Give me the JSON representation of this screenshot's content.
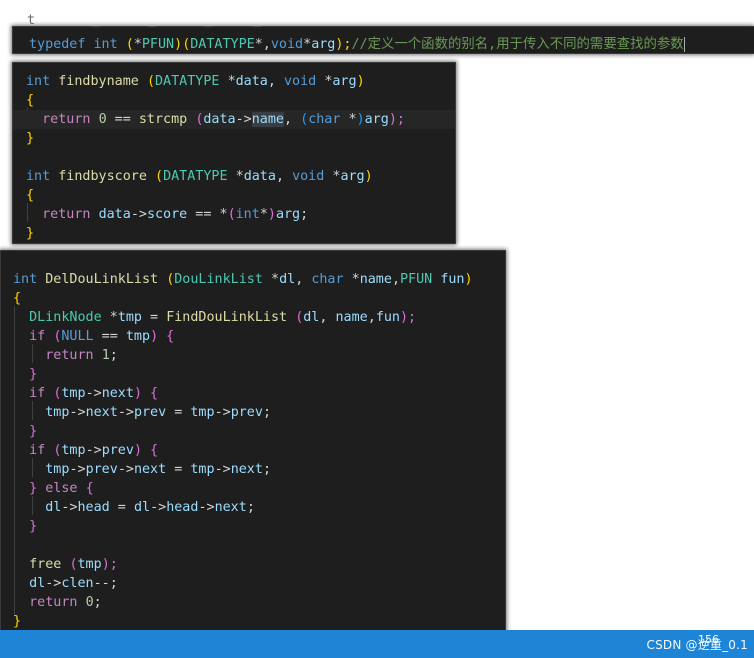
{
  "panel_top": {
    "lines": [
      [
        {
          "t": "typedef ",
          "c": "k"
        },
        {
          "t": "int ",
          "c": "k"
        },
        {
          "t": "(",
          "c": "b1"
        },
        {
          "t": "*",
          "c": "d"
        },
        {
          "t": "PFUN",
          "c": "t"
        },
        {
          "t": ")",
          "c": "b1"
        },
        {
          "t": "(",
          "c": "b1"
        },
        {
          "t": "DATATYPE",
          "c": "t"
        },
        {
          "t": "*,",
          "c": "d"
        },
        {
          "t": "void",
          "c": "k"
        },
        {
          "t": "*",
          "c": "d"
        },
        {
          "t": "arg",
          "c": "p"
        },
        {
          "t": ");",
          "c": "b1"
        },
        {
          "t": "//定义一个函数的别名,用于传入不同的需要查找的参数",
          "c": "cm"
        }
      ]
    ]
  },
  "panel_find": {
    "lines": [
      [
        {
          "t": "int ",
          "c": "k"
        },
        {
          "t": "findbyname ",
          "c": "f"
        },
        {
          "t": "(",
          "c": "b1"
        },
        {
          "t": "DATATYPE ",
          "c": "t"
        },
        {
          "t": "*",
          "c": "d"
        },
        {
          "t": "data",
          "c": "p"
        },
        {
          "t": ", ",
          "c": "d"
        },
        {
          "t": "void ",
          "c": "k"
        },
        {
          "t": "*",
          "c": "d"
        },
        {
          "t": "arg",
          "c": "p"
        },
        {
          "t": ")",
          "c": "b1"
        }
      ],
      [
        {
          "t": "{",
          "c": "b1"
        }
      ],
      [
        {
          "t": "  ",
          "c": "d"
        },
        {
          "t": "return ",
          "c": "c"
        },
        {
          "t": "0",
          "c": "n"
        },
        {
          "t": " == ",
          "c": "d"
        },
        {
          "t": "strcmp ",
          "c": "f"
        },
        {
          "t": "(",
          "c": "b2"
        },
        {
          "t": "data",
          "c": "p"
        },
        {
          "t": "->",
          "c": "d"
        },
        {
          "t": "name",
          "c": "v",
          "sel": true
        },
        {
          "t": ", ",
          "c": "d"
        },
        {
          "t": "(",
          "c": "b3"
        },
        {
          "t": "char ",
          "c": "k"
        },
        {
          "t": "*",
          "c": "d"
        },
        {
          "t": ")",
          "c": "b3"
        },
        {
          "t": "arg",
          "c": "p"
        },
        {
          "t": ");",
          "c": "b2"
        }
      ],
      [
        {
          "t": "}",
          "c": "b1"
        }
      ],
      [],
      [
        {
          "t": "int ",
          "c": "k"
        },
        {
          "t": "findbyscore ",
          "c": "f"
        },
        {
          "t": "(",
          "c": "b1"
        },
        {
          "t": "DATATYPE ",
          "c": "t"
        },
        {
          "t": "*",
          "c": "d"
        },
        {
          "t": "data",
          "c": "p"
        },
        {
          "t": ", ",
          "c": "d"
        },
        {
          "t": "void ",
          "c": "k"
        },
        {
          "t": "*",
          "c": "d"
        },
        {
          "t": "arg",
          "c": "p"
        },
        {
          "t": ")",
          "c": "b1"
        }
      ],
      [
        {
          "t": "{",
          "c": "b1"
        }
      ],
      [
        {
          "t": "  ",
          "c": "d"
        },
        {
          "t": "return ",
          "c": "c"
        },
        {
          "t": "data",
          "c": "p"
        },
        {
          "t": "->",
          "c": "d"
        },
        {
          "t": "score",
          "c": "v"
        },
        {
          "t": " == *",
          "c": "d"
        },
        {
          "t": "(",
          "c": "b2"
        },
        {
          "t": "int",
          "c": "k"
        },
        {
          "t": "*",
          "c": "d"
        },
        {
          "t": ")",
          "c": "b2"
        },
        {
          "t": "arg",
          "c": "p"
        },
        {
          "t": ";",
          "c": "d"
        }
      ],
      [
        {
          "t": "}",
          "c": "b1"
        }
      ]
    ]
  },
  "panel_del": {
    "lines": [
      [
        {
          "t": "int ",
          "c": "k"
        },
        {
          "t": "DelDouLinkList ",
          "c": "f"
        },
        {
          "t": "(",
          "c": "b1"
        },
        {
          "t": "DouLinkList ",
          "c": "t"
        },
        {
          "t": "*",
          "c": "d"
        },
        {
          "t": "dl",
          "c": "p"
        },
        {
          "t": ", ",
          "c": "d"
        },
        {
          "t": "char ",
          "c": "k"
        },
        {
          "t": "*",
          "c": "d"
        },
        {
          "t": "name",
          "c": "p"
        },
        {
          "t": ",",
          "c": "d"
        },
        {
          "t": "PFUN ",
          "c": "t"
        },
        {
          "t": "fun",
          "c": "p"
        },
        {
          "t": ")",
          "c": "b1"
        }
      ],
      [
        {
          "t": "{",
          "c": "b1"
        }
      ],
      [
        {
          "t": "  ",
          "c": "d"
        },
        {
          "t": "DLinkNode ",
          "c": "t"
        },
        {
          "t": "*",
          "c": "d"
        },
        {
          "t": "tmp",
          "c": "v"
        },
        {
          "t": " = ",
          "c": "d"
        },
        {
          "t": "FindDouLinkList ",
          "c": "f"
        },
        {
          "t": "(",
          "c": "b2"
        },
        {
          "t": "dl",
          "c": "p"
        },
        {
          "t": ", ",
          "c": "d"
        },
        {
          "t": "name",
          "c": "p"
        },
        {
          "t": ",",
          "c": "d"
        },
        {
          "t": "fun",
          "c": "p"
        },
        {
          "t": ");",
          "c": "b2"
        }
      ],
      [
        {
          "t": "  ",
          "c": "d"
        },
        {
          "t": "if ",
          "c": "c"
        },
        {
          "t": "(",
          "c": "b2"
        },
        {
          "t": "NULL",
          "c": "k"
        },
        {
          "t": " == ",
          "c": "d"
        },
        {
          "t": "tmp",
          "c": "v"
        },
        {
          "t": ") {",
          "c": "b2"
        }
      ],
      [
        {
          "t": "    ",
          "c": "d"
        },
        {
          "t": "return ",
          "c": "c"
        },
        {
          "t": "1",
          "c": "n"
        },
        {
          "t": ";",
          "c": "d"
        }
      ],
      [
        {
          "t": "  ",
          "c": "d"
        },
        {
          "t": "}",
          "c": "b2"
        }
      ],
      [
        {
          "t": "  ",
          "c": "d"
        },
        {
          "t": "if ",
          "c": "c"
        },
        {
          "t": "(",
          "c": "b2"
        },
        {
          "t": "tmp",
          "c": "v"
        },
        {
          "t": "->",
          "c": "d"
        },
        {
          "t": "next",
          "c": "v"
        },
        {
          "t": ") {",
          "c": "b2"
        }
      ],
      [
        {
          "t": "    ",
          "c": "d"
        },
        {
          "t": "tmp",
          "c": "v"
        },
        {
          "t": "->",
          "c": "d"
        },
        {
          "t": "next",
          "c": "v"
        },
        {
          "t": "->",
          "c": "d"
        },
        {
          "t": "prev",
          "c": "v"
        },
        {
          "t": " = ",
          "c": "d"
        },
        {
          "t": "tmp",
          "c": "v"
        },
        {
          "t": "->",
          "c": "d"
        },
        {
          "t": "prev",
          "c": "v"
        },
        {
          "t": ";",
          "c": "d"
        }
      ],
      [
        {
          "t": "  ",
          "c": "d"
        },
        {
          "t": "}",
          "c": "b2"
        }
      ],
      [
        {
          "t": "  ",
          "c": "d"
        },
        {
          "t": "if ",
          "c": "c"
        },
        {
          "t": "(",
          "c": "b2"
        },
        {
          "t": "tmp",
          "c": "v"
        },
        {
          "t": "->",
          "c": "d"
        },
        {
          "t": "prev",
          "c": "v"
        },
        {
          "t": ") {",
          "c": "b2"
        }
      ],
      [
        {
          "t": "    ",
          "c": "d"
        },
        {
          "t": "tmp",
          "c": "v"
        },
        {
          "t": "->",
          "c": "d"
        },
        {
          "t": "prev",
          "c": "v"
        },
        {
          "t": "->",
          "c": "d"
        },
        {
          "t": "next",
          "c": "v"
        },
        {
          "t": " = ",
          "c": "d"
        },
        {
          "t": "tmp",
          "c": "v"
        },
        {
          "t": "->",
          "c": "d"
        },
        {
          "t": "next",
          "c": "v"
        },
        {
          "t": ";",
          "c": "d"
        }
      ],
      [
        {
          "t": "  ",
          "c": "d"
        },
        {
          "t": "} ",
          "c": "b2"
        },
        {
          "t": "else ",
          "c": "c"
        },
        {
          "t": "{",
          "c": "b2"
        }
      ],
      [
        {
          "t": "    ",
          "c": "d"
        },
        {
          "t": "dl",
          "c": "p"
        },
        {
          "t": "->",
          "c": "d"
        },
        {
          "t": "head",
          "c": "v"
        },
        {
          "t": " = ",
          "c": "d"
        },
        {
          "t": "dl",
          "c": "p"
        },
        {
          "t": "->",
          "c": "d"
        },
        {
          "t": "head",
          "c": "v"
        },
        {
          "t": "->",
          "c": "d"
        },
        {
          "t": "next",
          "c": "v"
        },
        {
          "t": ";",
          "c": "d"
        }
      ],
      [
        {
          "t": "  ",
          "c": "d"
        },
        {
          "t": "}",
          "c": "b2"
        }
      ],
      [],
      [
        {
          "t": "  ",
          "c": "d"
        },
        {
          "t": "free ",
          "c": "f"
        },
        {
          "t": "(",
          "c": "b2"
        },
        {
          "t": "tmp",
          "c": "v"
        },
        {
          "t": ");",
          "c": "b2"
        }
      ],
      [
        {
          "t": "  ",
          "c": "d"
        },
        {
          "t": "dl",
          "c": "p"
        },
        {
          "t": "->",
          "c": "d"
        },
        {
          "t": "clen",
          "c": "v"
        },
        {
          "t": "--;",
          "c": "d"
        }
      ],
      [
        {
          "t": "  ",
          "c": "d"
        },
        {
          "t": "return ",
          "c": "c"
        },
        {
          "t": "0",
          "c": "n"
        },
        {
          "t": ";",
          "c": "d"
        }
      ],
      [
        {
          "t": "}",
          "c": "b1"
        }
      ]
    ]
  },
  "statusbar": {
    "number": "156",
    "watermark": "CSDN @逆重_0.1"
  }
}
